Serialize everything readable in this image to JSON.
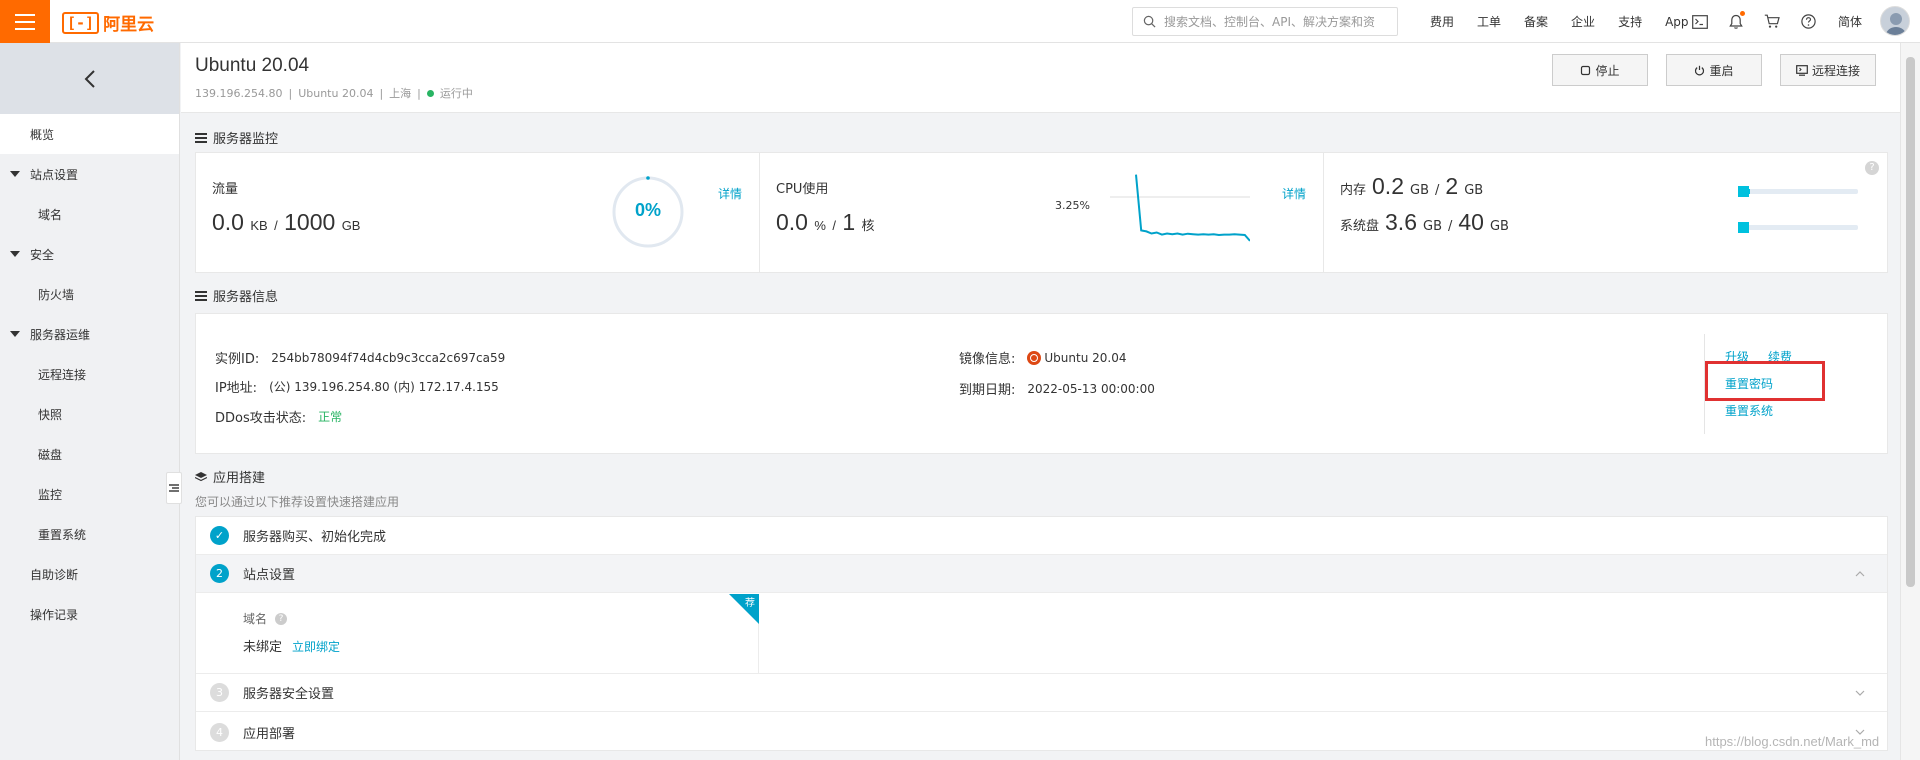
{
  "topbar": {
    "logo_text": "阿里云",
    "logo_mark": "[-]",
    "search_placeholder": "搜索文档、控制台、API、解决方案和资",
    "nav": [
      "费用",
      "工单",
      "备案",
      "企业",
      "支持",
      "App"
    ],
    "lang": "简体",
    "brand_color": "#ff6a00"
  },
  "sidebar": {
    "items": [
      {
        "label": "概览",
        "kind": "top",
        "active": true
      },
      {
        "label": "站点设置",
        "kind": "group"
      },
      {
        "label": "域名",
        "kind": "sub"
      },
      {
        "label": "安全",
        "kind": "group"
      },
      {
        "label": "防火墙",
        "kind": "sub"
      },
      {
        "label": "服务器运维",
        "kind": "group"
      },
      {
        "label": "远程连接",
        "kind": "sub"
      },
      {
        "label": "快照",
        "kind": "sub"
      },
      {
        "label": "磁盘",
        "kind": "sub"
      },
      {
        "label": "监控",
        "kind": "sub"
      },
      {
        "label": "重置系统",
        "kind": "sub"
      },
      {
        "label": "自助诊断",
        "kind": "top"
      },
      {
        "label": "操作记录",
        "kind": "top"
      }
    ]
  },
  "header": {
    "title": "Ubuntu 20.04",
    "ip": "139.196.254.80",
    "os": "Ubuntu 20.04",
    "region": "上海",
    "status": "运行中",
    "buttons": {
      "stop": "停止",
      "restart": "重启",
      "remote": "远程连接"
    }
  },
  "monitor": {
    "section_title": "服务器监控",
    "traffic": {
      "label": "流量",
      "used": "0.0",
      "used_unit": "KB",
      "total": "1000",
      "total_unit": "GB",
      "percent": "0%",
      "percent_value": 0,
      "detail": "详情"
    },
    "cpu": {
      "label": "CPU使用",
      "used": "0.0",
      "used_unit": "%",
      "total": "1",
      "total_unit": "核",
      "peak": "3.25%",
      "detail": "详情",
      "series": [
        3.25,
        0.6,
        0.55,
        0.45,
        0.5,
        0.4,
        0.45,
        0.42,
        0.45,
        0.4,
        0.44,
        0.42,
        0.4,
        0.42,
        0.4,
        0.42,
        0.38,
        0.4,
        0.4,
        0.42,
        0.4,
        0.38,
        0.1
      ]
    },
    "memory": {
      "label": "内存",
      "used": "0.2",
      "used_unit": "GB",
      "total": "2",
      "total_unit": "GB",
      "fraction": 0.1
    },
    "disk": {
      "label": "系统盘",
      "used": "3.6",
      "used_unit": "GB",
      "total": "40",
      "total_unit": "GB",
      "fraction": 0.09
    },
    "accent_color": "#00a2ca"
  },
  "info": {
    "section_title": "服务器信息",
    "instance_id_label": "实例ID:",
    "instance_id": "254bb78094f74d4cb9c3cca2c697ca59",
    "ip_label": "IP地址:",
    "ip_value": "(公) 139.196.254.80 (内) 172.17.4.155",
    "ddos_label": "DDos攻击状态:",
    "ddos_value": "正常",
    "image_label": "镜像信息:",
    "image_value": "Ubuntu 20.04",
    "expire_label": "到期日期:",
    "expire_value": "2022-05-13 00:00:00",
    "actions": {
      "upgrade": "升级",
      "renew": "续费",
      "reset_password": "重置密码",
      "reset_system": "重置系统"
    }
  },
  "app": {
    "section_title": "应用搭建",
    "subtitle": "您可以通过以下推荐设置快速搭建应用",
    "steps": [
      {
        "num": "✓",
        "label": "服务器购买、初始化完成"
      },
      {
        "num": "2",
        "label": "站点设置"
      },
      {
        "num": "3",
        "label": "服务器安全设置"
      },
      {
        "num": "4",
        "label": "应用部署"
      }
    ],
    "site_label": "域名",
    "site_state": "未绑定",
    "bind_link": "立即绑定",
    "rec_badge": "荐"
  },
  "watermark": "https://blog.csdn.net/Mark_md"
}
